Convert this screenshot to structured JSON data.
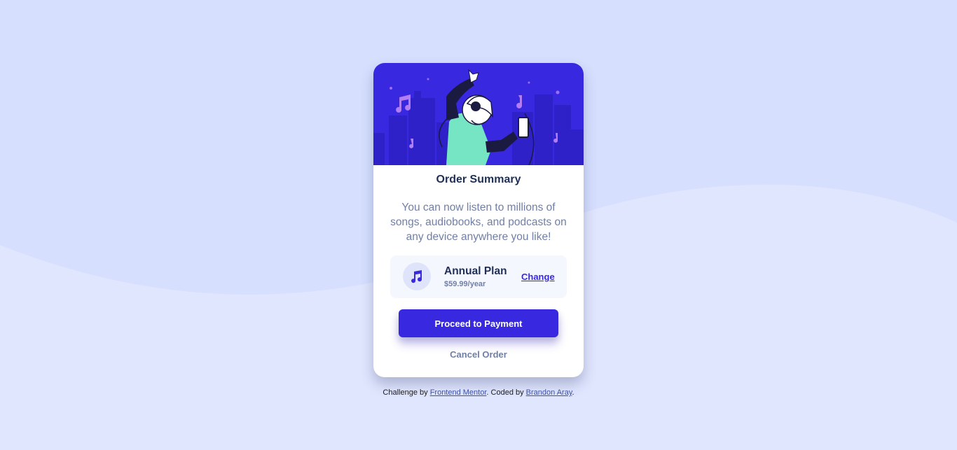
{
  "colors": {
    "background": "#e0e6fe",
    "wave": "#d6dffe",
    "hero": "#3829e0",
    "city": "#2d21c7",
    "accent": "#3829e0",
    "heading": "#1f2f56",
    "muted": "#717fa6",
    "plan_bg": "#f5f7ff"
  },
  "card": {
    "hero_alt": "illustration-hero",
    "title": "Order Summary",
    "description": "You can now listen to millions of songs, audiobooks, and podcasts on any device anywhere you like!",
    "plan": {
      "icon": "music-note-icon",
      "name": "Annual Plan",
      "price": "$59.99/year",
      "change_label": "Change"
    },
    "primary_button": "Proceed to Payment",
    "cancel_label": "Cancel Order"
  },
  "attribution": {
    "prefix": "Challenge by ",
    "frontend_mentor": "Frontend Mentor",
    "middle": ". Coded by ",
    "author": "Brandon Aray",
    "suffix": "."
  }
}
